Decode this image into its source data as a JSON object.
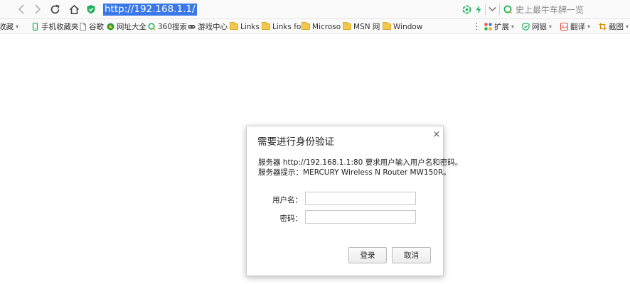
{
  "address_bar": {
    "url": "http://192.168.1.1/",
    "search_placeholder": "史上最牛车牌一览"
  },
  "bookmarks": {
    "items": [
      {
        "label": "收藏",
        "icon": "star-icon",
        "dropdown": true
      },
      {
        "label": "手机收藏夹",
        "icon": "phone-icon"
      },
      {
        "label": "谷歌",
        "icon": "page-icon"
      },
      {
        "label": "网址大全",
        "icon": "site-nav-icon"
      },
      {
        "label": "360搜索",
        "icon": "so-search-icon"
      },
      {
        "label": "游戏中心",
        "icon": "gamepad-icon"
      },
      {
        "label": "Links",
        "icon": "folder-icon"
      },
      {
        "label": "Links fo",
        "icon": "folder-icon"
      },
      {
        "label": "Microso",
        "icon": "folder-icon"
      },
      {
        "label": "MSN 网",
        "icon": "folder-icon"
      },
      {
        "label": "Window",
        "icon": "folder-icon"
      }
    ],
    "extensions": [
      {
        "label": "扩展",
        "icon": "extensions-icon"
      },
      {
        "label": "网银",
        "icon": "online-bank-icon"
      },
      {
        "label": "翻译",
        "icon": "translate-icon"
      },
      {
        "label": "截图",
        "icon": "screenshot-icon"
      }
    ]
  },
  "dialog": {
    "title": "需要进行身份验证",
    "close_glyph": "×",
    "message_line1": "服务器 http://192.168.1.1:80 要求用户输入用户名和密码。",
    "message_line2": "服务器提示：MERCURY Wireless N Router MW150R。",
    "username_label": "用户名：",
    "password_label": "密码：",
    "username_value": "",
    "password_value": "",
    "login_label": "登录",
    "cancel_label": "取消"
  },
  "colors": {
    "url_highlight": "#3b78e7",
    "shield_green": "#22b35e",
    "folder_yellow": "#f2c94c"
  }
}
